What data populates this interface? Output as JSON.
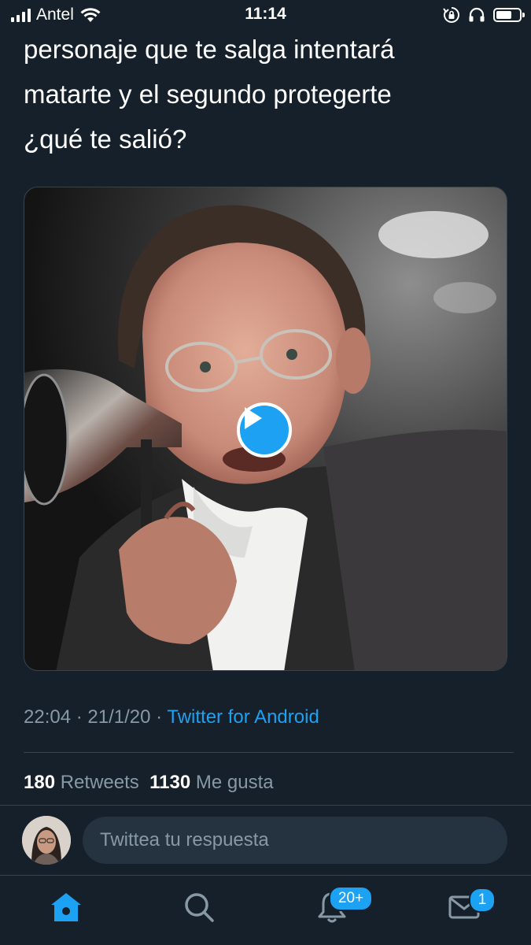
{
  "status_bar": {
    "carrier": "Antel",
    "time": "11:14"
  },
  "tweet": {
    "text_lines": [
      "personaje que te salga intentará",
      "matarte y el segundo protegerte",
      "¿qué te salió?"
    ],
    "time": "22:04",
    "date": "21/1/20",
    "source": "Twitter for Android",
    "separator": " · ",
    "retweets_count": "180",
    "retweets_label": "Retweets",
    "likes_count": "1130",
    "likes_label": "Me gusta"
  },
  "reply": {
    "placeholder": "Twittea tu respuesta"
  },
  "tab_bar": {
    "notifications_badge": "20+",
    "messages_badge": "1"
  },
  "colors": {
    "background": "#15202b",
    "accent": "#1da1f2",
    "secondary_text": "#8899a6"
  }
}
